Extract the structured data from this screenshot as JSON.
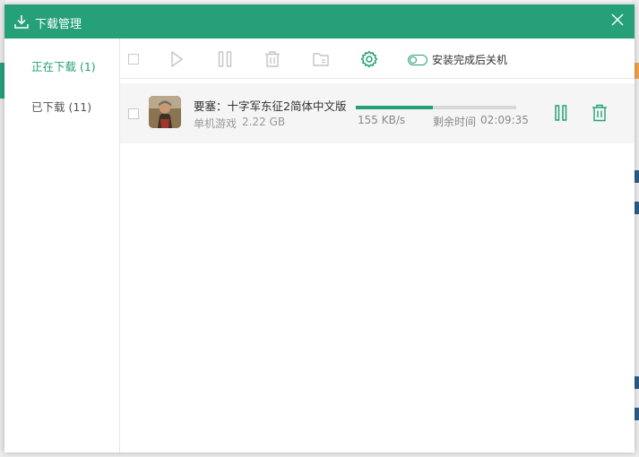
{
  "dialog": {
    "title": "下载管理"
  },
  "sidebar": {
    "items": [
      {
        "label": "正在下载 (1)",
        "active": true
      },
      {
        "label": "已下载 (11)",
        "active": false
      }
    ]
  },
  "toolbar": {
    "shutdown_toggle_label": "安装完成后关机",
    "shutdown_toggle_on": false
  },
  "downloads": [
    {
      "name": "要塞：十字军东征2简体中文版",
      "category": "单机游戏",
      "size": "2.22 GB",
      "speed": "155 KB/s",
      "remaining_label": "剩余时间",
      "remaining": "02:09:35",
      "progress_fraction": 0.48
    }
  ],
  "colors": {
    "accent": "#26a079",
    "icon_gray": "#c4c4c4",
    "progress_track": "#d8d8d8"
  },
  "icons": {
    "title": "download-icon",
    "close": "close-icon",
    "toolbar": [
      "select-all-checkbox",
      "play-icon",
      "pause-icon",
      "trash-icon",
      "folder-icon",
      "gear-icon"
    ],
    "row": [
      "pause-icon",
      "trash-icon"
    ]
  }
}
